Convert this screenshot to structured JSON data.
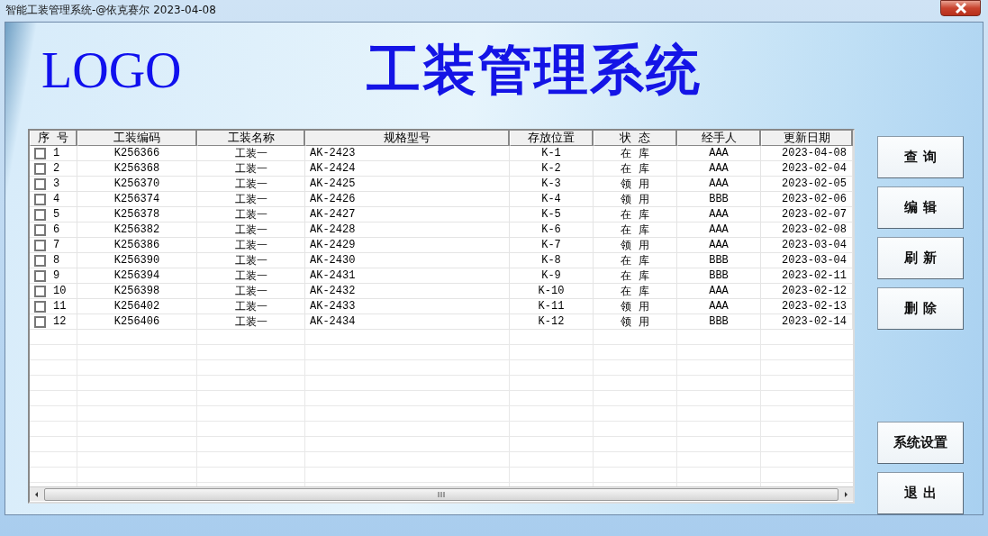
{
  "window": {
    "title": "智能工装管理系统-@依克赛尔 2023-04-08"
  },
  "header": {
    "logo": "LOGO",
    "title": "工装管理系统"
  },
  "table": {
    "columns": [
      "序 号",
      "工装编码",
      "工装名称",
      "规格型号",
      "存放位置",
      "状 态",
      "经手人",
      "更新日期"
    ],
    "rows": [
      {
        "checked": false,
        "cells": [
          "1",
          "K256366",
          "工装一",
          "AK-2423",
          "K-1",
          "在 库",
          "AAA",
          "2023-04-08"
        ]
      },
      {
        "checked": false,
        "cells": [
          "2",
          "K256368",
          "工装一",
          "AK-2424",
          "K-2",
          "在 库",
          "AAA",
          "2023-02-04"
        ]
      },
      {
        "checked": false,
        "cells": [
          "3",
          "K256370",
          "工装一",
          "AK-2425",
          "K-3",
          "领 用",
          "AAA",
          "2023-02-05"
        ]
      },
      {
        "checked": false,
        "cells": [
          "4",
          "K256374",
          "工装一",
          "AK-2426",
          "K-4",
          "领 用",
          "BBB",
          "2023-02-06"
        ]
      },
      {
        "checked": false,
        "cells": [
          "5",
          "K256378",
          "工装一",
          "AK-2427",
          "K-5",
          "在 库",
          "AAA",
          "2023-02-07"
        ]
      },
      {
        "checked": false,
        "cells": [
          "6",
          "K256382",
          "工装一",
          "AK-2428",
          "K-6",
          "在 库",
          "AAA",
          "2023-02-08"
        ]
      },
      {
        "checked": false,
        "cells": [
          "7",
          "K256386",
          "工装一",
          "AK-2429",
          "K-7",
          "领 用",
          "AAA",
          "2023-03-04"
        ]
      },
      {
        "checked": false,
        "cells": [
          "8",
          "K256390",
          "工装一",
          "AK-2430",
          "K-8",
          "在 库",
          "BBB",
          "2023-03-04"
        ]
      },
      {
        "checked": false,
        "cells": [
          "9",
          "K256394",
          "工装一",
          "AK-2431",
          "K-9",
          "在 库",
          "BBB",
          "2023-02-11"
        ]
      },
      {
        "checked": false,
        "cells": [
          "10",
          "K256398",
          "工装一",
          "AK-2432",
          "K-10",
          "在 库",
          "AAA",
          "2023-02-12"
        ]
      },
      {
        "checked": false,
        "cells": [
          "11",
          "K256402",
          "工装一",
          "AK-2433",
          "K-11",
          "领 用",
          "AAA",
          "2023-02-13"
        ]
      },
      {
        "checked": false,
        "cells": [
          "12",
          "K256406",
          "工装一",
          "AK-2434",
          "K-12",
          "领 用",
          "BBB",
          "2023-02-14"
        ]
      }
    ]
  },
  "buttons_top": [
    "查 询",
    "编 辑",
    "刷 新",
    "删 除"
  ],
  "buttons_bottom": [
    "系统设置",
    "退 出"
  ]
}
